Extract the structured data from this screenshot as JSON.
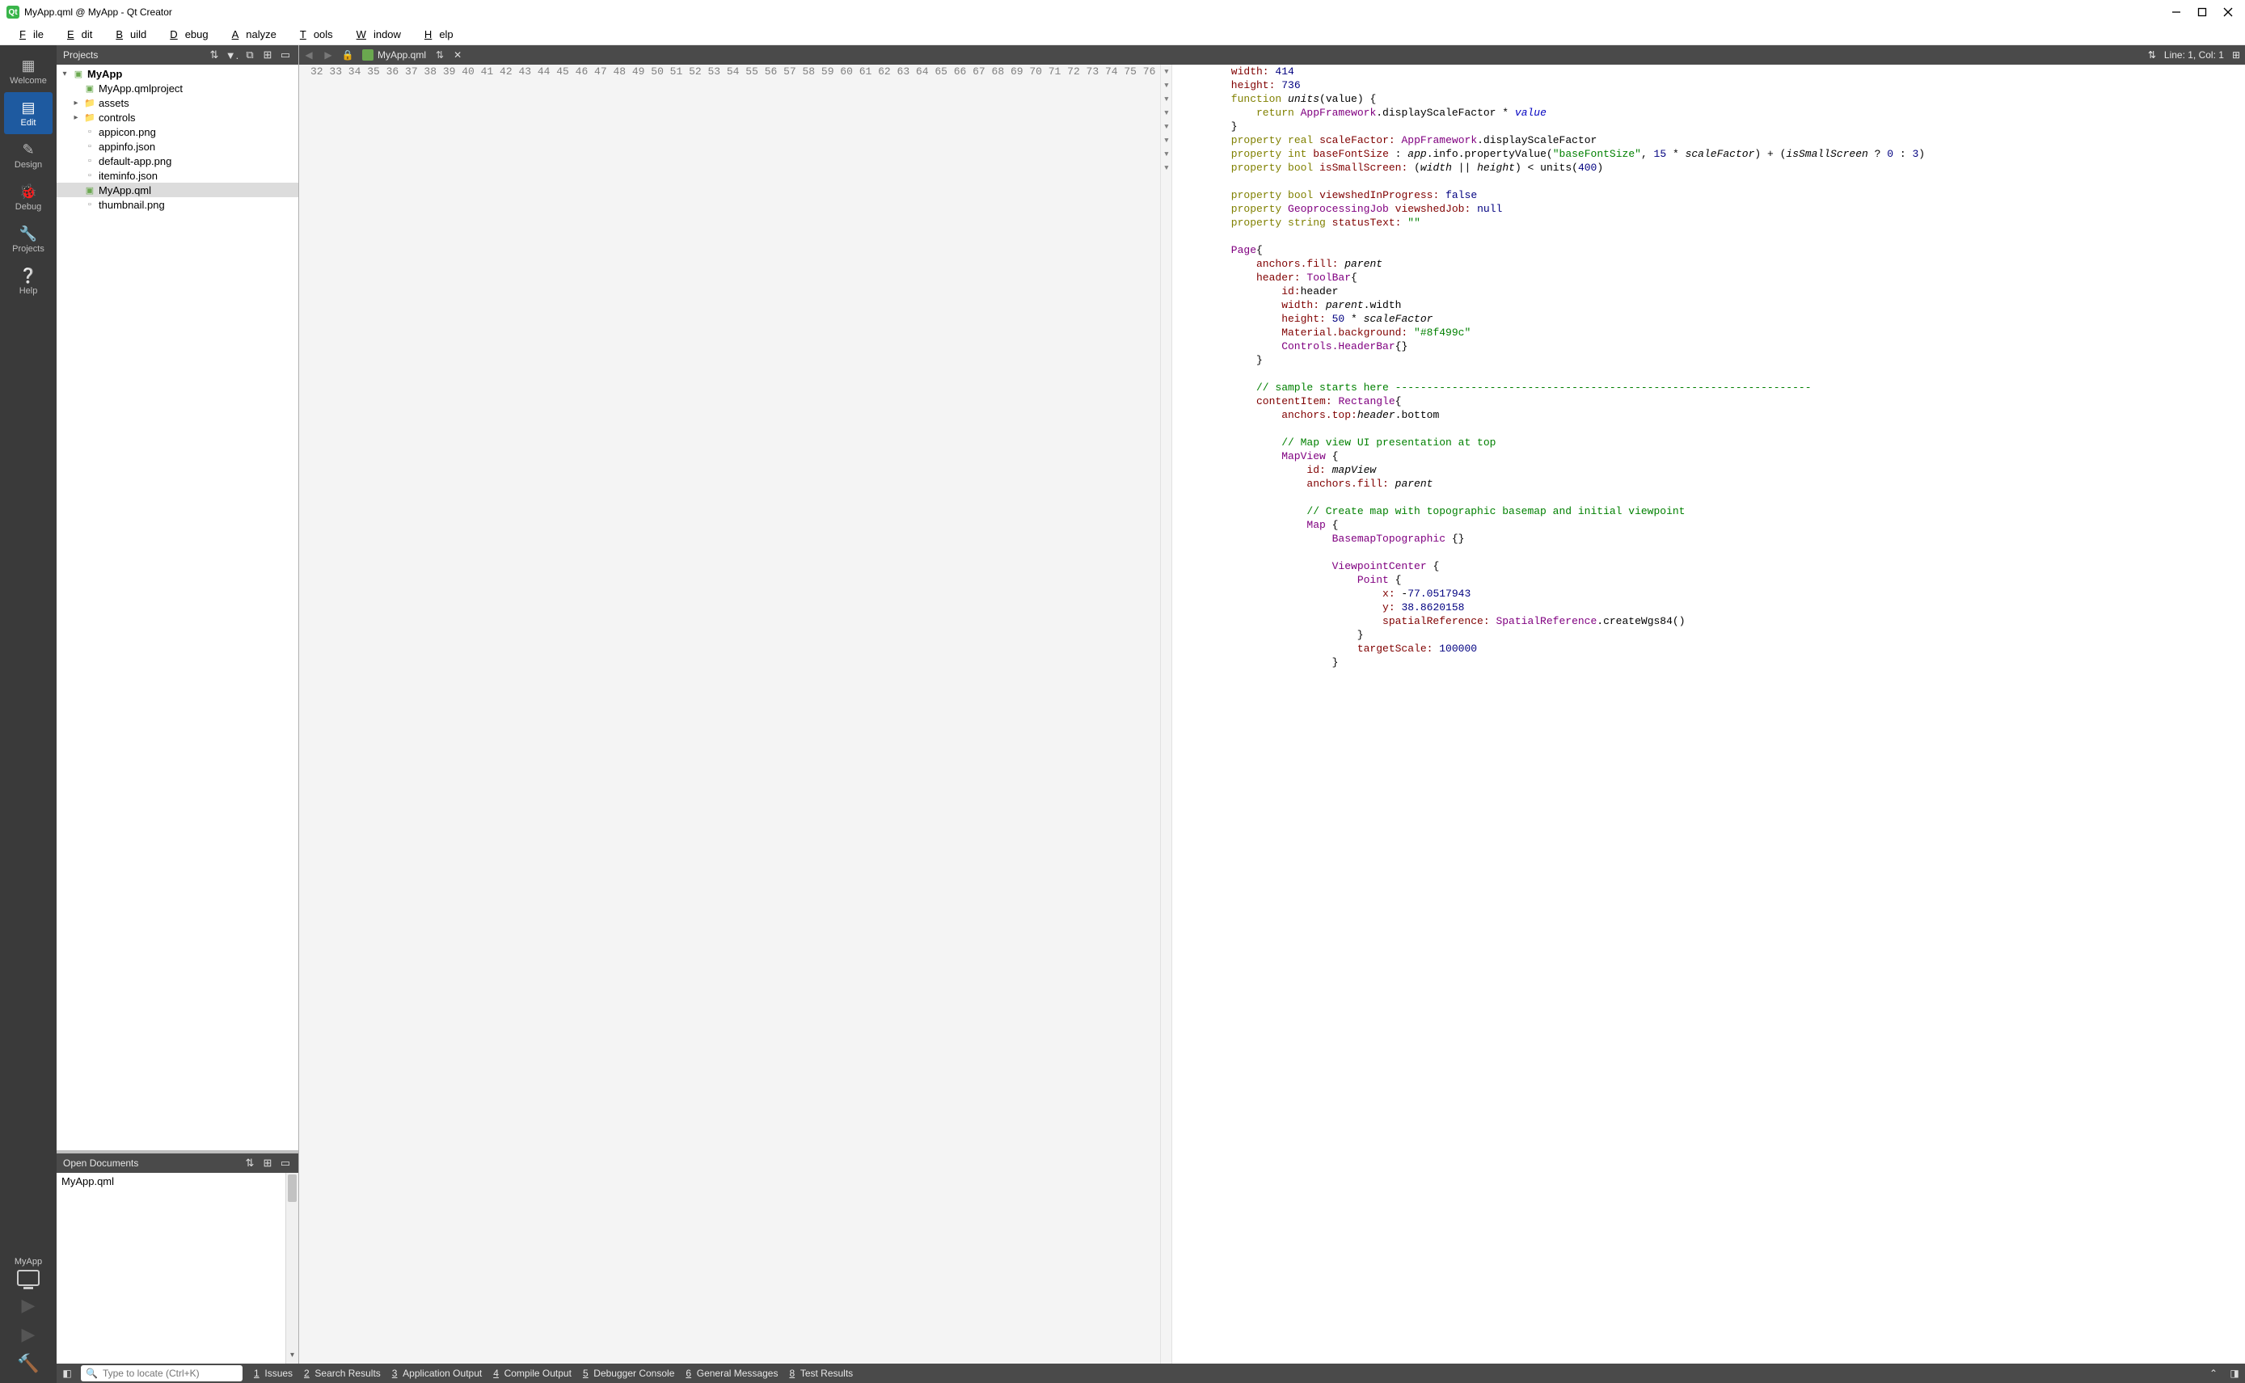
{
  "window": {
    "title": "MyApp.qml @ MyApp - Qt Creator"
  },
  "menu": {
    "file": "File",
    "edit": "Edit",
    "build": "Build",
    "debug": "Debug",
    "analyze": "Analyze",
    "tools": "Tools",
    "window": "Window",
    "help": "Help"
  },
  "modes": {
    "welcome": "Welcome",
    "edit": "Edit",
    "design": "Design",
    "debug": "Debug",
    "projects": "Projects",
    "help": "Help"
  },
  "kit": {
    "name": "MyApp"
  },
  "projects_panel": {
    "title": "Projects",
    "root": "MyApp",
    "items": [
      {
        "name": "MyApp.qmlproject",
        "icon": "proj"
      },
      {
        "name": "assets",
        "icon": "folder",
        "expandable": true
      },
      {
        "name": "controls",
        "icon": "folder",
        "expandable": true
      },
      {
        "name": "appicon.png",
        "icon": "img"
      },
      {
        "name": "appinfo.json",
        "icon": "json"
      },
      {
        "name": "default-app.png",
        "icon": "img"
      },
      {
        "name": "iteminfo.json",
        "icon": "json"
      },
      {
        "name": "MyApp.qml",
        "icon": "qml",
        "selected": true
      },
      {
        "name": "thumbnail.png",
        "icon": "img"
      }
    ]
  },
  "open_docs": {
    "title": "Open Documents",
    "items": [
      "MyApp.qml"
    ]
  },
  "editor": {
    "file": "MyApp.qml",
    "cursor": "Line: 1, Col: 1",
    "gutter_start": 32,
    "fold_lines": [
      34,
      45,
      47,
      56,
      60,
      65,
      68,
      69
    ],
    "lines": [
      [
        [
          "        "
        ],
        [
          "width:",
          "name"
        ],
        [
          " "
        ],
        [
          "414",
          "num"
        ]
      ],
      [
        [
          "        "
        ],
        [
          "height:",
          "name"
        ],
        [
          " "
        ],
        [
          "736",
          "num"
        ]
      ],
      [
        [
          "        "
        ],
        [
          "function",
          "kw"
        ],
        [
          " "
        ],
        [
          "units",
          "ital"
        ],
        [
          "(value) {"
        ]
      ],
      [
        [
          "            "
        ],
        [
          "return",
          "kw"
        ],
        [
          " "
        ],
        [
          "AppFramework",
          "builtin"
        ],
        [
          ".displayScaleFactor * "
        ],
        [
          "value",
          "italv"
        ]
      ],
      [
        [
          "        }"
        ]
      ],
      [
        [
          "        "
        ],
        [
          "property",
          "kw"
        ],
        [
          " "
        ],
        [
          "real",
          "kw"
        ],
        [
          " "
        ],
        [
          "scaleFactor:",
          "name"
        ],
        [
          " "
        ],
        [
          "AppFramework",
          "builtin"
        ],
        [
          ".displayScaleFactor"
        ]
      ],
      [
        [
          "        "
        ],
        [
          "property",
          "kw"
        ],
        [
          " "
        ],
        [
          "int",
          "kw"
        ],
        [
          " "
        ],
        [
          "baseFontSize",
          "name"
        ],
        [
          " : "
        ],
        [
          "app",
          "ital"
        ],
        [
          ".info.propertyValue("
        ],
        [
          "\"baseFontSize\"",
          "str"
        ],
        [
          ", "
        ],
        [
          "15",
          "num"
        ],
        [
          " * "
        ],
        [
          "scaleFactor",
          "ital"
        ],
        [
          ") + ("
        ],
        [
          "isSmallScreen",
          "ital"
        ],
        [
          " ? "
        ],
        [
          "0",
          "num"
        ],
        [
          " : "
        ],
        [
          "3",
          "num"
        ],
        [
          ")"
        ]
      ],
      [
        [
          "        "
        ],
        [
          "property",
          "kw"
        ],
        [
          " "
        ],
        [
          "bool",
          "kw"
        ],
        [
          " "
        ],
        [
          "isSmallScreen:",
          "name"
        ],
        [
          " ("
        ],
        [
          "width",
          "ital"
        ],
        [
          " || "
        ],
        [
          "height",
          "ital"
        ],
        [
          ") < units("
        ],
        [
          "400",
          "num"
        ],
        [
          ")"
        ]
      ],
      [
        [
          ""
        ]
      ],
      [
        [
          "        "
        ],
        [
          "property",
          "kw"
        ],
        [
          " "
        ],
        [
          "bool",
          "kw"
        ],
        [
          " "
        ],
        [
          "viewshedInProgress:",
          "name"
        ],
        [
          " "
        ],
        [
          "false",
          "num"
        ]
      ],
      [
        [
          "        "
        ],
        [
          "property",
          "kw"
        ],
        [
          " "
        ],
        [
          "GeoprocessingJob",
          "builtin"
        ],
        [
          " "
        ],
        [
          "viewshedJob:",
          "name"
        ],
        [
          " "
        ],
        [
          "null",
          "num"
        ]
      ],
      [
        [
          "        "
        ],
        [
          "property",
          "kw"
        ],
        [
          " "
        ],
        [
          "string",
          "kw"
        ],
        [
          " "
        ],
        [
          "statusText:",
          "name"
        ],
        [
          " "
        ],
        [
          "\"\"",
          "str"
        ]
      ],
      [
        [
          ""
        ]
      ],
      [
        [
          "        "
        ],
        [
          "Page",
          "builtin"
        ],
        [
          "{"
        ]
      ],
      [
        [
          "            "
        ],
        [
          "anchors.fill:",
          "name"
        ],
        [
          " "
        ],
        [
          "parent",
          "ital"
        ]
      ],
      [
        [
          "            "
        ],
        [
          "header:",
          "name"
        ],
        [
          " "
        ],
        [
          "ToolBar",
          "builtin"
        ],
        [
          "{"
        ]
      ],
      [
        [
          "                "
        ],
        [
          "id:",
          "name"
        ],
        [
          "header"
        ]
      ],
      [
        [
          "                "
        ],
        [
          "width:",
          "name"
        ],
        [
          " "
        ],
        [
          "parent",
          "ital"
        ],
        [
          ".width"
        ]
      ],
      [
        [
          "                "
        ],
        [
          "height:",
          "name"
        ],
        [
          " "
        ],
        [
          "50",
          "num"
        ],
        [
          " * "
        ],
        [
          "scaleFactor",
          "ital"
        ]
      ],
      [
        [
          "                "
        ],
        [
          "Material.background:",
          "name"
        ],
        [
          " "
        ],
        [
          "\"#8f499c\"",
          "str"
        ]
      ],
      [
        [
          "                "
        ],
        [
          "Controls.HeaderBar",
          "builtin"
        ],
        [
          "{}"
        ]
      ],
      [
        [
          "            }"
        ]
      ],
      [
        [
          ""
        ]
      ],
      [
        [
          "            "
        ],
        [
          "// sample starts here ------------------------------------------------------------------",
          "comment"
        ]
      ],
      [
        [
          "            "
        ],
        [
          "contentItem:",
          "name"
        ],
        [
          " "
        ],
        [
          "Rectangle",
          "builtin"
        ],
        [
          "{"
        ]
      ],
      [
        [
          "                "
        ],
        [
          "anchors.top:",
          "name"
        ],
        [
          "header",
          "ital"
        ],
        [
          ".bottom"
        ]
      ],
      [
        [
          ""
        ]
      ],
      [
        [
          "                "
        ],
        [
          "// Map view UI presentation at top",
          "comment"
        ]
      ],
      [
        [
          "                "
        ],
        [
          "MapView",
          "builtin"
        ],
        [
          " {"
        ]
      ],
      [
        [
          "                    "
        ],
        [
          "id:",
          "name"
        ],
        [
          " "
        ],
        [
          "mapView",
          "ital"
        ]
      ],
      [
        [
          "                    "
        ],
        [
          "anchors.fill:",
          "name"
        ],
        [
          " "
        ],
        [
          "parent",
          "ital"
        ]
      ],
      [
        [
          ""
        ]
      ],
      [
        [
          "                    "
        ],
        [
          "// Create map with topographic basemap and initial viewpoint",
          "comment"
        ]
      ],
      [
        [
          "                    "
        ],
        [
          "Map",
          "builtin"
        ],
        [
          " {"
        ]
      ],
      [
        [
          "                        "
        ],
        [
          "BasemapTopographic",
          "builtin"
        ],
        [
          " {}"
        ]
      ],
      [
        [
          ""
        ]
      ],
      [
        [
          "                        "
        ],
        [
          "ViewpointCenter",
          "builtin"
        ],
        [
          " {"
        ]
      ],
      [
        [
          "                            "
        ],
        [
          "Point",
          "builtin"
        ],
        [
          " {"
        ]
      ],
      [
        [
          "                                "
        ],
        [
          "x:",
          "name"
        ],
        [
          " -"
        ],
        [
          "77.0517943",
          "num"
        ]
      ],
      [
        [
          "                                "
        ],
        [
          "y:",
          "name"
        ],
        [
          " "
        ],
        [
          "38.8620158",
          "num"
        ]
      ],
      [
        [
          "                                "
        ],
        [
          "spatialReference:",
          "name"
        ],
        [
          " "
        ],
        [
          "SpatialReference",
          "builtin"
        ],
        [
          ".createWgs84()"
        ]
      ],
      [
        [
          "                            }"
        ]
      ],
      [
        [
          "                            "
        ],
        [
          "targetScale:",
          "name"
        ],
        [
          " "
        ],
        [
          "100000",
          "num"
        ]
      ],
      [
        [
          "                        }"
        ]
      ],
      [
        [
          ""
        ]
      ]
    ]
  },
  "locator": {
    "placeholder": "Type to locate (Ctrl+K)"
  },
  "outputs": {
    "issues": "Issues",
    "search": "Search Results",
    "app": "Application Output",
    "compile": "Compile Output",
    "dbg": "Debugger Console",
    "msg": "General Messages",
    "test": "Test Results"
  }
}
